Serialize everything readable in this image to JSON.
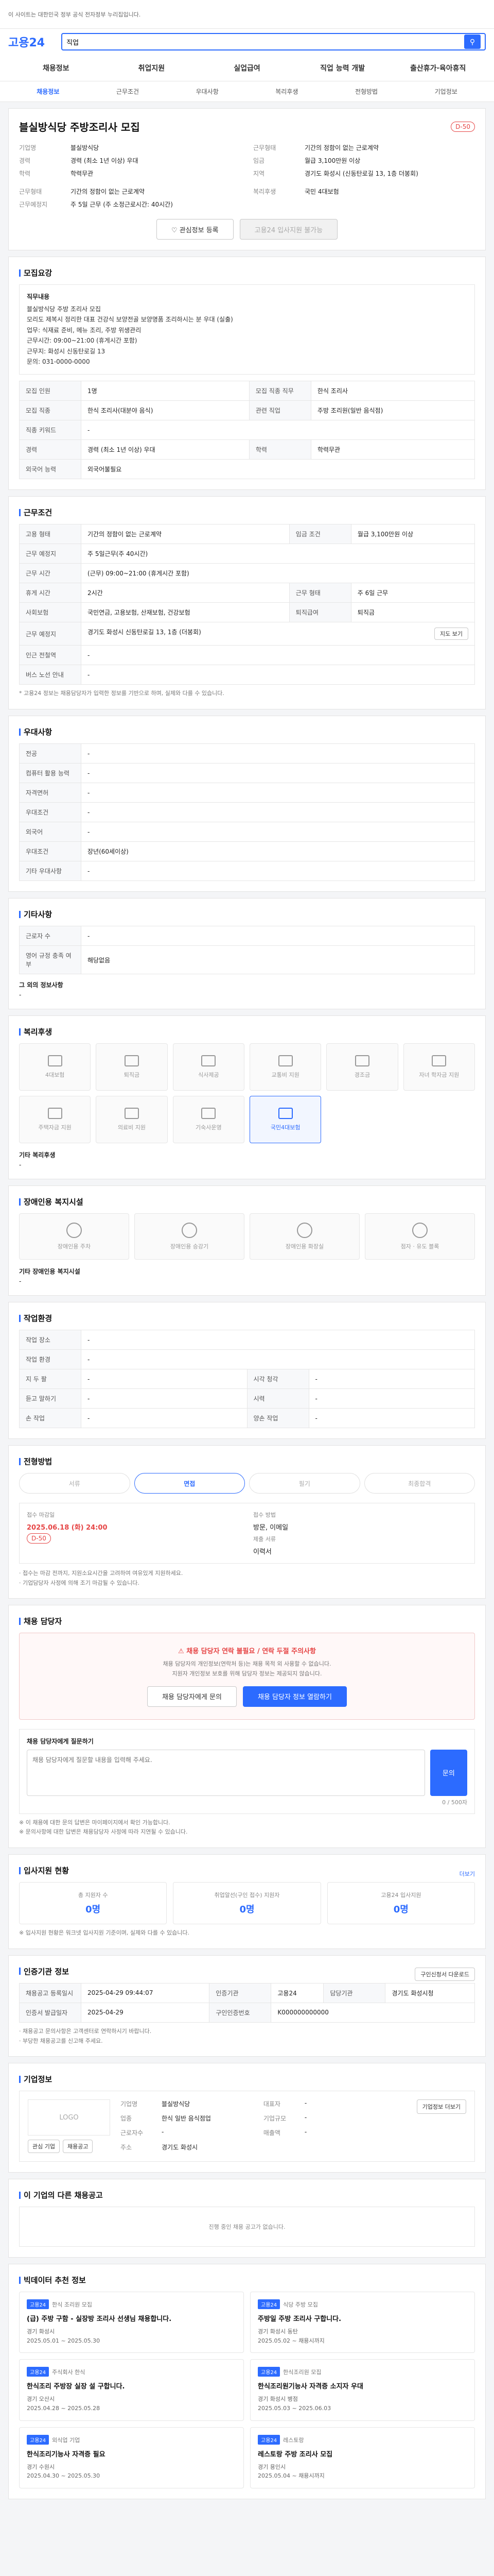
{
  "top": {
    "notice": "이 사이트는 대한민국 정부 공식 전자정부 누리집입니다.",
    "search_value": "직업",
    "logo": "고용24"
  },
  "gnb": [
    "채용정보",
    "취업지원",
    "실업급여",
    "직업 능력 개발",
    "출산휴가·육아휴직"
  ],
  "lnb": [
    "채용정보",
    "근무조건",
    "우대사항",
    "복리후생",
    "전형방법",
    "기업정보"
  ],
  "job": {
    "company": "블실방식당 주방조리사 모집",
    "dday": "D-50",
    "info_left": [
      {
        "k": "기업명",
        "v": "블실방식당"
      },
      {
        "k": "경력",
        "v": "경력 (최소 1년 이상) 우대"
      },
      {
        "k": "학력",
        "v": "학력무관"
      }
    ],
    "info_right": [
      {
        "k": "근무형태",
        "v": "기간의 정함이 없는 근로계약"
      },
      {
        "k": "임금",
        "v": "월급 3,100만원 이상"
      },
      {
        "k": "지역",
        "v": "경기도 화성시 (신동탄로길 13, 1층 더봉회)"
      }
    ],
    "work_left": [
      {
        "k": "근무형태",
        "v": "기간의 정함이 없는 근로계약"
      },
      {
        "k": "근무예정지",
        "v": "주 5일 근무 (주 소정근로시간: 40시간)"
      }
    ],
    "work_right": [
      {
        "k": "복리후생",
        "v": "국민 4대보험"
      }
    ],
    "btn_scrap": "관심정보 등록",
    "btn_apply": "고용24 입사지원 불가능"
  },
  "recruit": {
    "title": "모집요강",
    "duty_label": "직무내용",
    "duty_text": "블실방식당 주방 조리사 모집\n모리도 제복시 정리한 대표 건강식 보양전골 보양명품 조리하시는 분 우대 (실출)\n업무: 식재료 준비, 메뉴 조리, 주방 위생관리\n근무시간: 09:00~21:00 (휴게시간 포함)\n근무지: 화성시 신동탄로길 13\n문의: 031-0000-0000",
    "rows": [
      {
        "k": "모집 인원",
        "v": "1명",
        "k2": "모집 직종 직무",
        "v2": "한식 조리사"
      },
      {
        "k": "모집 직종",
        "v": "한식 조리사(대분야 음식)",
        "k2": "관련 직업",
        "v2": "주방 조리원(일반 음식점)"
      },
      {
        "k": "직종 키워드",
        "v": "-",
        "k2": "",
        "v2": ""
      },
      {
        "k": "경력",
        "v": "경력 (최소 1년 이상) 우대",
        "k2": "학력",
        "v2": "학력무관"
      },
      {
        "k": "외국어 능력",
        "v": "외국어불필요",
        "k2": "",
        "v2": ""
      }
    ]
  },
  "conditions": {
    "title": "근무조건",
    "rows": [
      {
        "k": "고용 형태",
        "v": "기간의 정함이 없는 근로계약",
        "k2": "임금 조건",
        "v2": "월급 3,100만원 이상"
      },
      {
        "k": "근무 예정지",
        "v": "주 5일근무(주 40시간)",
        "k2": "",
        "v2": ""
      },
      {
        "k": "근무 시간",
        "v": "(근무) 09:00~21:00 (휴게시간 포함)",
        "k2": "",
        "v2": ""
      },
      {
        "k": "휴게 시간",
        "v": "2시간",
        "k2": "근무 형태",
        "v2": "주 6일 근무"
      },
      {
        "k": "사회보험",
        "v": "국민연금, 고용보험, 산재보험, 건강보험",
        "k2": "퇴직급여",
        "v2": "퇴직금"
      },
      {
        "k": "근무 예정지",
        "v": "경기도 화성시 신동탄로길 13, 1층 (더봉회)",
        "k2": "",
        "v2": ""
      },
      {
        "k": "인근 전철역",
        "v": "-",
        "k2": "",
        "v2": ""
      },
      {
        "k": "버스 노선 안내",
        "v": "-",
        "k2": "",
        "v2": ""
      }
    ],
    "map_btn": "지도 보기",
    "note": "* 고용24 정보는 채용담당자가 입력한 정보를 기반으로 하며, 실제와 다를 수 있습니다."
  },
  "preferences": {
    "title": "우대사항",
    "rows": [
      {
        "k": "전공",
        "v": "-"
      },
      {
        "k": "컴퓨터 활용 능력",
        "v": "-"
      },
      {
        "k": "자격면허",
        "v": "-"
      },
      {
        "k": "우대조건",
        "v": "-"
      },
      {
        "k": "외국어",
        "v": "-"
      },
      {
        "k": "우대조건",
        "v": "장년(60세이상)"
      },
      {
        "k": "기타 우대사항",
        "v": "-"
      }
    ]
  },
  "others": {
    "title": "기타사항",
    "rows": [
      {
        "k": "근로자 수",
        "v": "-"
      },
      {
        "k": "영어 규정 충족 여부",
        "v": "해당없음"
      }
    ],
    "extra_label": "그 외의 정보사항",
    "extra_value": "-"
  },
  "welfare": {
    "title": "복리후생",
    "items": [
      {
        "label": "4대보험",
        "icon": "shield-icon",
        "on": false
      },
      {
        "label": "퇴직금",
        "icon": "money-icon",
        "on": false
      },
      {
        "label": "식사제공",
        "icon": "meal-icon",
        "on": false
      },
      {
        "label": "교통비 지원",
        "icon": "bus-icon",
        "on": false
      },
      {
        "label": "경조금",
        "icon": "gift-icon",
        "on": false
      },
      {
        "label": "자녀 학자금 지원",
        "icon": "education-icon",
        "on": false
      },
      {
        "label": "주택자금 지원",
        "icon": "house-icon",
        "on": false
      },
      {
        "label": "의료비 지원",
        "icon": "medical-icon",
        "on": false
      },
      {
        "label": "기숙사운영",
        "icon": "dorm-icon",
        "on": false
      },
      {
        "label": "국민4대보험",
        "icon": "insurance-icon",
        "on": true
      }
    ],
    "extra_label": "기타 복리후생",
    "extra_value": "-"
  },
  "disability": {
    "title": "장애인용 복지시설",
    "items": [
      {
        "label": "장애인용 주차",
        "icon": "parking-icon"
      },
      {
        "label": "장애인용 승강기",
        "icon": "elevator-icon"
      },
      {
        "label": "장애인용 화장실",
        "icon": "toilet-icon"
      },
      {
        "label": "점자 · 유도 블록",
        "icon": "braille-icon"
      }
    ],
    "extra_label": "기타 장애인용 복지시설",
    "extra_value": "-"
  },
  "work_env": {
    "title": "작업환경",
    "rows": [
      {
        "k": "작업 장소",
        "v": "-",
        "k2": "",
        "v2": ""
      },
      {
        "k": "작업 환경",
        "v": "-",
        "k2": "",
        "v2": ""
      },
      {
        "k": "지 두 팔",
        "v": "-",
        "k2": "시각 청각",
        "v2": "-"
      },
      {
        "k": "듣고 말하기",
        "v": "-",
        "k2": "시력",
        "v2": "-"
      },
      {
        "k": "손 작업",
        "v": "-",
        "k2": "양손 작업",
        "v2": "-"
      }
    ]
  },
  "process": {
    "title": "전형방법",
    "steps": [
      "서류",
      "면접",
      "필기",
      "최종합격"
    ],
    "active": 1,
    "period_label": "접수 마감일",
    "period_value": "2025.06.18 (화) 24:00",
    "dday": "D-50",
    "method_label": "접수 방법",
    "method_value": "방문, 이메일",
    "docs_label": "제출 서류",
    "docs_value": "이력서",
    "notes": "· 접수는 마감 전까지, 지원소요시간을 고려하여 여유있게 지원하세요.\n· 기업담당자 사정에 의해 조기 마감될 수 있습니다."
  },
  "contact": {
    "title": "채용 담당자",
    "warn": "채용 담당자 연락 불필요 / 연락 두절 주의사항",
    "desc": "채용 담당자의 개인정보(연락처 등)는 채용 목적 외 사용할 수 없습니다.",
    "desc2": "지원자 개인정보 보호를 위해 담당자 정보는 제공되지 않습니다.",
    "btn1": "채용 담당자에게 문의",
    "btn2": "채용 담당자 정보 열람하기",
    "inquiry_label": "채용 담당자에게 질문하기",
    "inquiry_placeholder": "채용 담당자에게 질문할 내용을 입력해 주세요.",
    "inquiry_count": "0 / 500자",
    "inquiry_btn": "문의",
    "note1": "※ 이 채용에 대한 문의 답변은 마이페이지에서 확인 가능합니다.",
    "note2": "※ 문의사항에 대한 답변은 채용담당자 사정에 따라 지연될 수 있습니다."
  },
  "stats": {
    "title": "입사지원 현황",
    "detail": "더보기",
    "items": [
      {
        "label": "총 지원자 수",
        "value": "0명"
      },
      {
        "label": "취업알선(구인 접수) 지원자",
        "value": "0명"
      },
      {
        "label": "고용24 입사지원",
        "value": "0명"
      }
    ],
    "note": "※ 입사지원 현황은 워크넷 입사지원 기준이며, 실제와 다를 수 있습니다."
  },
  "meta": {
    "title": "인증기관 정보",
    "btn": "구인신청서 다운로드",
    "rows": [
      {
        "k": "채용공고 등록일시",
        "v": "2025-04-29 09:44:07",
        "k2": "인증기관",
        "v2": "고용24",
        "k3": "담당기관",
        "v3": "경기도 화성시청"
      },
      {
        "k": "인증서 발급일자",
        "v": "2025-04-29",
        "k2": "구인인증번호",
        "v2": "K000000000000",
        "k3": "",
        "v3": ""
      }
    ],
    "note": "· 채용공고 문의사항은 고객센터로 연락하시기 바랍니다.\n· 부당한 채용공고를 신고해 주세요."
  },
  "company": {
    "title": "기업정보",
    "logo_text": "LOGO",
    "name_label": "기업명",
    "name": "블실방식당",
    "rep_label": "대표자",
    "rep": "-",
    "industry_label": "업종",
    "industry": "한식 일반 음식점업",
    "size_label": "기업규모",
    "size": "-",
    "emp_label": "근로자수",
    "emp": "-",
    "sales_label": "매출액",
    "sales": "-",
    "address_label": "주소",
    "address": "경기도 화성시",
    "detail_btn": "기업정보 더보기",
    "btn1": "관심 기업",
    "btn2": "채용공고"
  },
  "same_company": {
    "title": "이 기업의 다른 채용공고",
    "empty": "진행 중인 채용 공고가 없습니다."
  },
  "recommend": {
    "title": "빅데이터 추천 정보",
    "items": [
      {
        "tag": "고용24",
        "company": "한식 조리원 모집",
        "title": "(급) 주방 구함 - 실장방 조리사 선생님 채용합니다.",
        "meta1": "경기 화성시",
        "meta2": "2025.05.01 ~ 2025.05.30"
      },
      {
        "tag": "고용24",
        "company": "식당 주방 모집",
        "title": "주방일 주방 조리사 구합니다.",
        "meta1": "경기 화성시 동탄",
        "meta2": "2025.05.02 ~ 채용시까지"
      },
      {
        "tag": "고용24",
        "company": "주식회사 한식",
        "title": "한식조리 주방장 실장 설 구합니다.",
        "meta1": "경기 오산시",
        "meta2": "2025.04.28 ~ 2025.05.28"
      },
      {
        "tag": "고용24",
        "company": "한식조리원 모집",
        "title": "한식조리원기능사 자격증 소지자 우대",
        "meta1": "경기 화성시 병점",
        "meta2": "2025.05.03 ~ 2025.06.03"
      },
      {
        "tag": "고용24",
        "company": "외식업 기업",
        "title": "한식조리기능사 자격증 필요",
        "meta1": "경기 수원시",
        "meta2": "2025.04.30 ~ 2025.05.30"
      },
      {
        "tag": "고용24",
        "company": "레스토랑",
        "title": "레스토랑 주방 조리사 모집",
        "meta1": "경기 용인시",
        "meta2": "2025.05.04 ~ 채용시까지"
      }
    ]
  }
}
